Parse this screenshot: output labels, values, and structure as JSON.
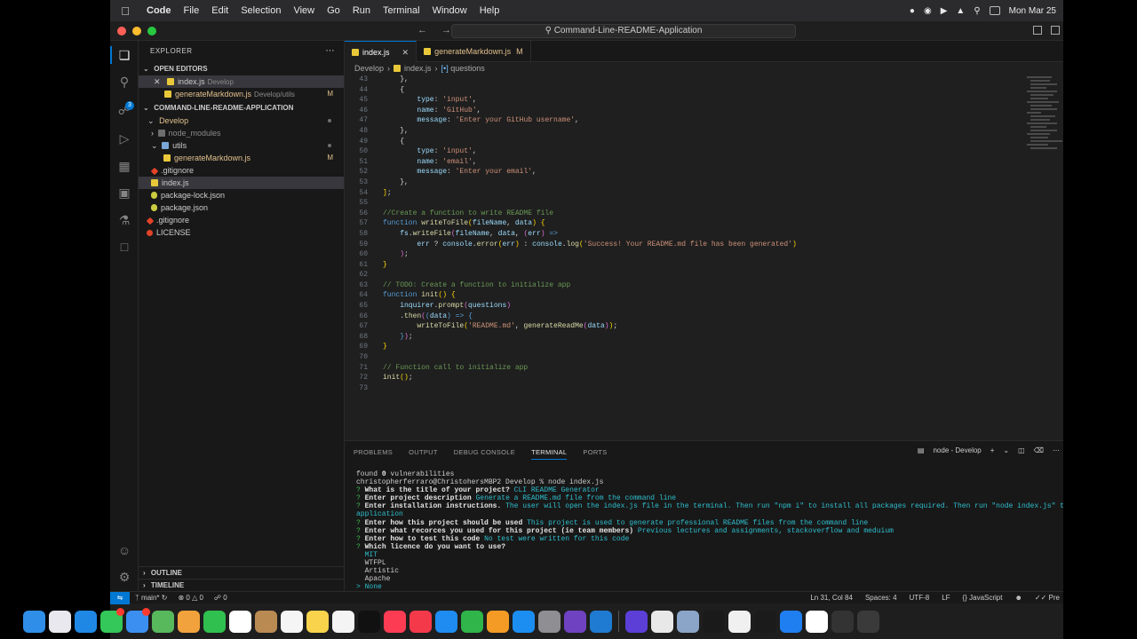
{
  "menubar": {
    "app": "Code",
    "items": [
      "File",
      "Edit",
      "Selection",
      "View",
      "Go",
      "Run",
      "Terminal",
      "Window",
      "Help"
    ],
    "clock": "Mon Mar 25"
  },
  "window": {
    "search_title": "Command-Line-README-Application"
  },
  "sidebar": {
    "title": "EXPLORER",
    "open_editors_label": "OPEN EDITORS",
    "open_editors": [
      {
        "name": "index.js",
        "desc": "Develop",
        "status": ""
      },
      {
        "name": "generateMarkdown.js",
        "desc": "Develop/utils",
        "status": "M"
      }
    ],
    "project_label": "COMMAND-LINE-README-APPLICATION",
    "tree": {
      "develop": "Develop",
      "node_modules": "node_modules",
      "utils": "utils",
      "generate": "generateMarkdown.js",
      "generate_status": "M",
      "gitignore_inner": ".gitignore",
      "index": "index.js",
      "lock": "package-lock.json",
      "pkg": "package.json",
      "gitignore_root": ".gitignore",
      "license": "LICENSE"
    },
    "outline_label": "OUTLINE",
    "timeline_label": "TIMELINE"
  },
  "editor": {
    "tabs": [
      {
        "name": "index.js",
        "active": true,
        "status": ""
      },
      {
        "name": "generateMarkdown.js",
        "active": false,
        "status": "M"
      }
    ],
    "breadcrumb": [
      "Develop",
      "index.js",
      "questions"
    ]
  },
  "code_lines": [
    {
      "n": "43",
      "html": "<span class=\"o\">    },</span>"
    },
    {
      "n": "44",
      "html": "<span class=\"o\">    {</span>"
    },
    {
      "n": "45",
      "html": "        <span class=\"v\">type</span><span class=\"o\">: </span><span class=\"s\">'input'</span><span class=\"o\">,</span>"
    },
    {
      "n": "46",
      "html": "        <span class=\"v\">name</span><span class=\"o\">: </span><span class=\"s\">'GitHub'</span><span class=\"o\">,</span>"
    },
    {
      "n": "47",
      "html": "        <span class=\"v\">message</span><span class=\"o\">: </span><span class=\"s\">'Enter your GitHub username'</span><span class=\"o\">,</span>"
    },
    {
      "n": "48",
      "html": "<span class=\"o\">    },</span>"
    },
    {
      "n": "49",
      "html": "<span class=\"o\">    {</span>"
    },
    {
      "n": "50",
      "html": "        <span class=\"v\">type</span><span class=\"o\">: </span><span class=\"s\">'input'</span><span class=\"o\">,</span>"
    },
    {
      "n": "51",
      "html": "        <span class=\"v\">name</span><span class=\"o\">: </span><span class=\"s\">'email'</span><span class=\"o\">,</span>"
    },
    {
      "n": "52",
      "html": "        <span class=\"v\">message</span><span class=\"o\">: </span><span class=\"s\">'Enter your email'</span><span class=\"o\">,</span>"
    },
    {
      "n": "53",
      "html": "<span class=\"o\">    },</span>"
    },
    {
      "n": "54",
      "html": "<span class=\"b\">]</span><span class=\"o\">;</span>"
    },
    {
      "n": "55",
      "html": ""
    },
    {
      "n": "56",
      "html": "<span class=\"c\">//Create a function to write README file</span>"
    },
    {
      "n": "57",
      "html": "<span class=\"k\">function</span> <span class=\"f\">writeToFile</span><span class=\"b\">(</span><span class=\"v\">fileName</span><span class=\"o\">, </span><span class=\"v\">data</span><span class=\"b\">)</span> <span class=\"b\">{</span>"
    },
    {
      "n": "58",
      "html": "    <span class=\"v\">fs</span><span class=\"o\">.</span><span class=\"f\">writeFile</span><span class=\"p\">(</span><span class=\"v\">fileName</span><span class=\"o\">, </span><span class=\"v\">data</span><span class=\"o\">, </span><span class=\"p\">(</span><span class=\"v\">err</span><span class=\"p\">)</span> <span class=\"k\">=&gt;</span>"
    },
    {
      "n": "59",
      "html": "        <span class=\"v\">err</span> <span class=\"o\">?</span> <span class=\"v\">console</span><span class=\"o\">.</span><span class=\"f\">error</span><span class=\"b\">(</span><span class=\"v\">err</span><span class=\"b\">)</span> <span class=\"o\">:</span> <span class=\"v\">console</span><span class=\"o\">.</span><span class=\"f\">log</span><span class=\"b\">(</span><span class=\"s\">'Success! Your README.md file has been generated'</span><span class=\"b\">)</span>"
    },
    {
      "n": "60",
      "html": "    <span class=\"p\">)</span><span class=\"o\">;</span>"
    },
    {
      "n": "61",
      "html": "<span class=\"b\">}</span>"
    },
    {
      "n": "62",
      "html": ""
    },
    {
      "n": "63",
      "html": "<span class=\"c\">// TODO: Create a function to initialize app</span>"
    },
    {
      "n": "64",
      "html": "<span class=\"k\">function</span> <span class=\"f\">init</span><span class=\"b\">()</span> <span class=\"b\">{</span>"
    },
    {
      "n": "65",
      "html": "    <span class=\"v\">inquirer</span><span class=\"o\">.</span><span class=\"f\">prompt</span><span class=\"p\">(</span><span class=\"v\">questions</span><span class=\"p\">)</span>"
    },
    {
      "n": "66",
      "html": "    <span class=\"o\">.</span><span class=\"f\">then</span><span class=\"p\">(</span><span class=\"k\">(</span><span class=\"v\">data</span><span class=\"k\">)</span> <span class=\"k\">=&gt;</span> <span class=\"k\">{</span>"
    },
    {
      "n": "67",
      "html": "        <span class=\"f\">writeToFile</span><span class=\"b\">(</span><span class=\"s\">'README.md'</span><span class=\"o\">, </span><span class=\"f\">generateReadMe</span><span class=\"p\">(</span><span class=\"v\">data</span><span class=\"p\">)</span><span class=\"b\">)</span><span class=\"o\">;</span>"
    },
    {
      "n": "68",
      "html": "    <span class=\"k\">}</span><span class=\"p\">)</span><span class=\"o\">;</span>"
    },
    {
      "n": "69",
      "html": "<span class=\"b\">}</span>"
    },
    {
      "n": "70",
      "html": ""
    },
    {
      "n": "71",
      "html": "<span class=\"c\">// Function call to initialize app</span>"
    },
    {
      "n": "72",
      "html": "<span class=\"f\">init</span><span class=\"b\">()</span><span class=\"o\">;</span>"
    },
    {
      "n": "73",
      "html": ""
    }
  ],
  "panel": {
    "tabs": [
      "PROBLEMS",
      "OUTPUT",
      "DEBUG CONSOLE",
      "TERMINAL",
      "PORTS"
    ],
    "active_tab": "TERMINAL",
    "terminal_name": "node - Develop"
  },
  "terminal_lines": [
    {
      "html": "found <b class=\"tb\">0</b> vulnerabilities"
    },
    {
      "html": "christopherferraro@ChristohersMBP2 Develop % node index.js"
    },
    {
      "html": "<span class=\"tq\">?</span> <span class=\"tb\">What is the title of your project?</span> <span class=\"ta\">CLI README Generator</span>"
    },
    {
      "html": "<span class=\"tq\">?</span> <span class=\"tb\">Enter project description</span> <span class=\"ta\">Generate a README.md file from the command line</span>"
    },
    {
      "html": "<span class=\"tq\">?</span> <span class=\"tb\">Enter installation instructions.</span> <span class=\"ta\">The user will open the index.js file in the terminal. Then run \"npm i\" to install all packages required. Then run \"node index.js\" to start the</span>"
    },
    {
      "html": "<span class=\"ta\">application</span>"
    },
    {
      "html": "<span class=\"tq\">?</span> <span class=\"tb\">Enter how this project should be used</span> <span class=\"ta\">This project is used to generate professional README files from the command line</span>"
    },
    {
      "html": "<span class=\"tq\">?</span> <span class=\"tb\">Enter what recorces you used for this project (ie team members)</span> <span class=\"ta\">Previous lectures and assignments, stackoverflow and meduium</span>"
    },
    {
      "html": "<span class=\"tq\">?</span> <span class=\"tb\">Enter how to test this code</span> <span class=\"ta\">No test were written for this code</span>"
    },
    {
      "html": "<span class=\"tq\">?</span> <span class=\"tb\">Which licence do you want to use?</span>"
    },
    {
      "html": "  <span class=\"ta\">MIT</span>"
    },
    {
      "html": "  WTFPL"
    },
    {
      "html": "  Artistic"
    },
    {
      "html": "  Apache"
    },
    {
      "html": "<span class=\"ta\">&gt; None</span>"
    }
  ],
  "statusbar": {
    "branch": "main*",
    "errors": "0",
    "warnings": "0",
    "ports": "0",
    "position": "Ln 31, Col 84",
    "spaces": "Spaces: 4",
    "encoding": "UTF-8",
    "eol": "LF",
    "language": "JavaScript",
    "prettier": "Pre"
  },
  "dock": {
    "apps": [
      {
        "name": "finder",
        "color": "#2f8fe8"
      },
      {
        "name": "launchpad",
        "color": "#e8e8ee"
      },
      {
        "name": "safari",
        "color": "#1f88e5"
      },
      {
        "name": "messages",
        "color": "#34c759",
        "notif": true
      },
      {
        "name": "mail",
        "color": "#3b8ff0",
        "notif": true
      },
      {
        "name": "maps",
        "color": "#58b85c"
      },
      {
        "name": "photos",
        "color": "#f2a23c"
      },
      {
        "name": "facetime",
        "color": "#30c04f"
      },
      {
        "name": "calendar",
        "color": "#ffffff"
      },
      {
        "name": "contacts",
        "color": "#b98a52"
      },
      {
        "name": "reminders",
        "color": "#f5f5f5"
      },
      {
        "name": "notes",
        "color": "#f8d34b"
      },
      {
        "name": "freeform",
        "color": "#f4f4f4"
      },
      {
        "name": "tv",
        "color": "#111111"
      },
      {
        "name": "music",
        "color": "#fb3c53"
      },
      {
        "name": "news",
        "color": "#f4394b"
      },
      {
        "name": "keynote",
        "color": "#1e8cf0"
      },
      {
        "name": "numbers",
        "color": "#2fb54a"
      },
      {
        "name": "pages",
        "color": "#f39b24"
      },
      {
        "name": "app-store",
        "color": "#1c8ef2"
      },
      {
        "name": "system-settings",
        "color": "#8e8e93"
      },
      {
        "name": "github-desktop",
        "color": "#6f42c1"
      },
      {
        "name": "vscode",
        "color": "#1f7bd1"
      }
    ],
    "apps2": [
      {
        "name": "screen-recorder",
        "color": "#5b3fd6"
      },
      {
        "name": "chrome",
        "color": "#e8e8e8"
      },
      {
        "name": "preview",
        "color": "#8aa5c8"
      },
      {
        "name": "mongodb",
        "color": "#1a1a1a"
      },
      {
        "name": "textedit",
        "color": "#f0f0f0"
      },
      {
        "name": "terminal",
        "color": "#1b1b1b"
      },
      {
        "name": "bluetooth",
        "color": "#1f7ff0"
      },
      {
        "name": "github",
        "color": "#ffffff"
      },
      {
        "name": "downloads",
        "color": "#333333"
      },
      {
        "name": "trash",
        "color": "#3a3a3a"
      }
    ]
  }
}
